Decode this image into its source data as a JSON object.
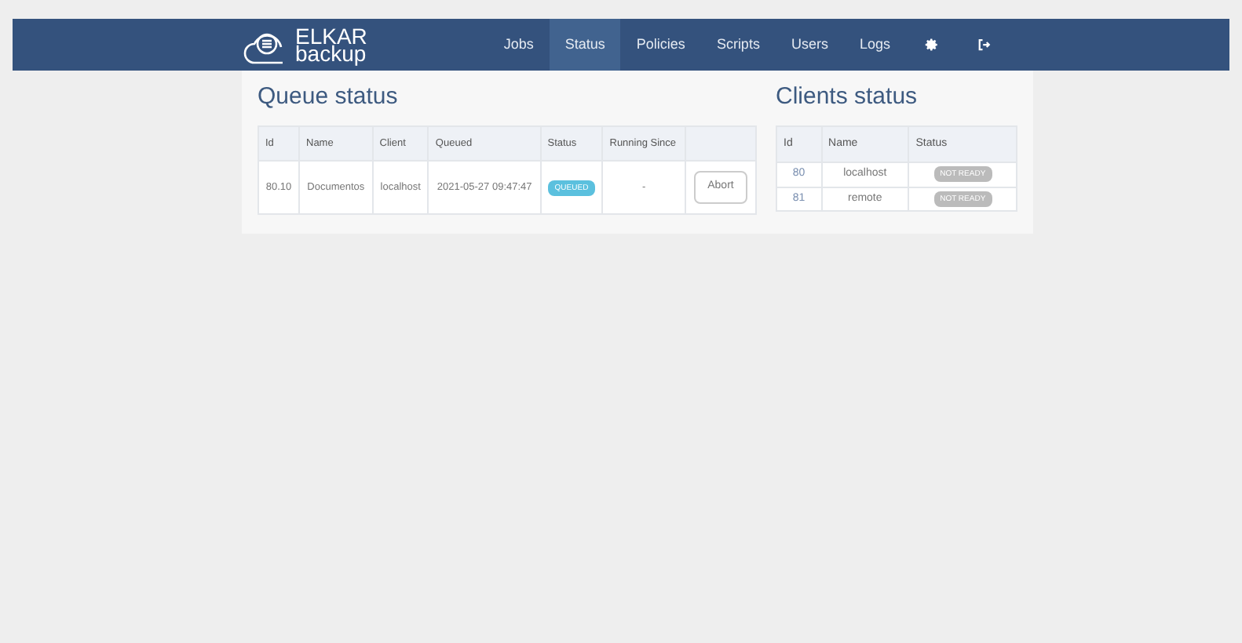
{
  "navbar": {
    "logo": {
      "top": "ELKAR",
      "bottom": "backup"
    },
    "links": [
      {
        "kind": "text",
        "label": "Jobs",
        "selected": false
      },
      {
        "kind": "text",
        "label": "Status",
        "selected": true
      },
      {
        "kind": "text",
        "label": "Policies",
        "selected": false
      },
      {
        "kind": "text",
        "label": "Scripts",
        "selected": false
      },
      {
        "kind": "text",
        "label": "Users",
        "selected": false
      },
      {
        "kind": "text",
        "label": "Logs",
        "selected": false
      },
      {
        "kind": "settings",
        "selected": false
      },
      {
        "kind": "logout",
        "selected": false
      }
    ]
  },
  "queue": {
    "title": "Queue status",
    "columns": [
      "Id",
      "Name",
      "Client",
      "Queued",
      "Status",
      "Running Since"
    ],
    "rows": [
      {
        "id": "80.10",
        "name": "Documentos",
        "client": "localhost",
        "queued": "2021-05-27 09:47:47",
        "status": "QUEUED",
        "color": "#5bc0de",
        "running_since": "-",
        "action": "Abort"
      }
    ]
  },
  "clients": {
    "title": "Clients status",
    "columns": [
      "Id",
      "Name",
      "Status"
    ],
    "rows": [
      {
        "id": "80",
        "name": "localhost",
        "status": "NOT READY",
        "color": "#bbbbbb"
      },
      {
        "id": "81",
        "name": "remote",
        "status": "NOT READY",
        "color": "#bbbbbb"
      }
    ]
  }
}
